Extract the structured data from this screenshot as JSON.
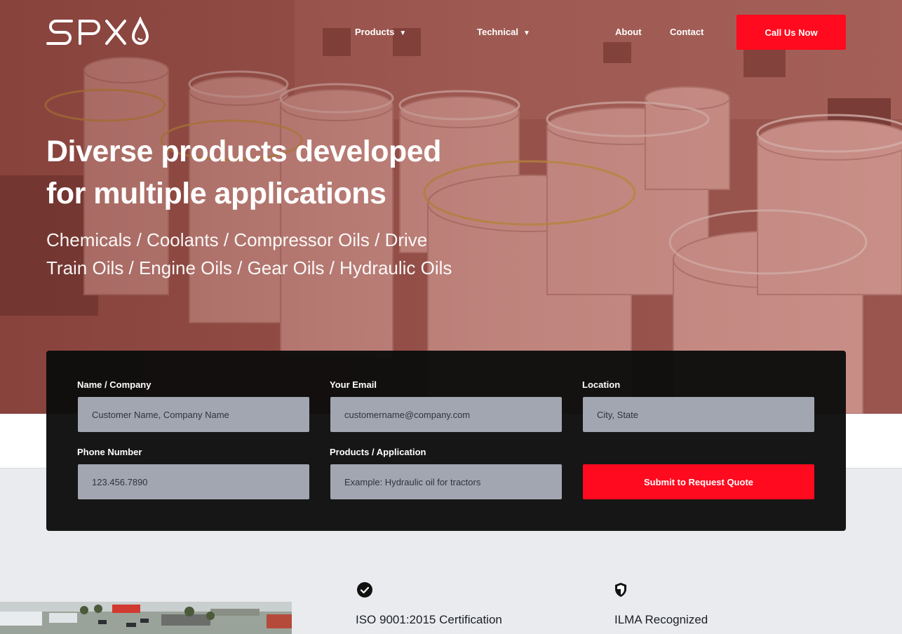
{
  "brand": {
    "logo_text": "SPX"
  },
  "nav": {
    "products_label": "Products",
    "technical_label": "Technical",
    "about_label": "About",
    "contact_label": "Contact",
    "dropdown_caret": "▼",
    "call_label": "Call Us Now"
  },
  "hero": {
    "title_line1": "Diverse products developed",
    "title_line2": "for multiple applications",
    "subtitle_line1": "Chemicals / Coolants / Compressor Oils / Drive",
    "subtitle_line2": "Train Oils / Engine Oils / Gear Oils / Hydraulic Oils"
  },
  "quote_form": {
    "name": {
      "label": "Name / Company",
      "placeholder": "Customer Name, Company Name"
    },
    "email": {
      "label": "Your Email",
      "placeholder": "customername@company.com"
    },
    "location": {
      "label": "Location",
      "placeholder": "City, State"
    },
    "phone": {
      "label": "Phone Number",
      "placeholder": "123.456.7890"
    },
    "products": {
      "label": "Products / Application",
      "placeholder": "Example: Hydraulic oil for tractors"
    },
    "submit_label": "Submit to Request Quote"
  },
  "features": {
    "iso_title": "ISO 9001:2015 Certification",
    "ilma_title": "ILMA Recognized"
  },
  "colors": {
    "accent_red": "#ff0a1f",
    "form_bg": "#0c0c0c",
    "field_bg": "#a1a6b1",
    "hero_tint": "#8a4a44"
  }
}
